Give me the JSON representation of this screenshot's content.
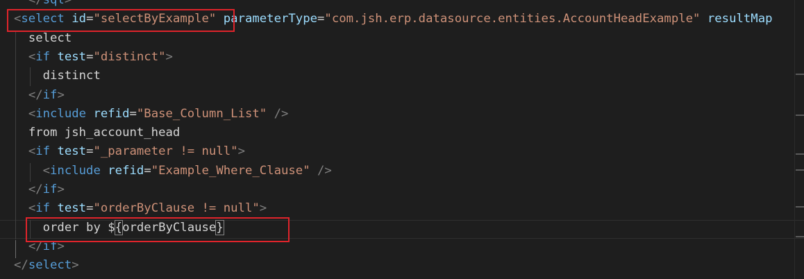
{
  "editor": {
    "lines": [
      {
        "indent": "  ",
        "parts": [
          [
            "punct",
            "</"
          ],
          [
            "tag",
            "sql"
          ],
          [
            "punct",
            ">"
          ]
        ]
      },
      {
        "indent": "",
        "parts": [
          [
            "punct",
            "<"
          ],
          [
            "tag",
            "select"
          ],
          [
            "text",
            " "
          ],
          [
            "attr",
            "id"
          ],
          [
            "eq",
            "="
          ],
          [
            "str",
            "\"selectByExample\""
          ],
          [
            "text",
            " "
          ],
          [
            "attr",
            "parameterType"
          ],
          [
            "eq",
            "="
          ],
          [
            "str",
            "\"com.jsh.erp.datasource.entities.AccountHeadExample\""
          ],
          [
            "text",
            " "
          ],
          [
            "attr",
            "resultMap"
          ]
        ]
      },
      {
        "indent": "  ",
        "parts": [
          [
            "text",
            "select"
          ]
        ]
      },
      {
        "indent": "  ",
        "parts": [
          [
            "punct",
            "<"
          ],
          [
            "tag",
            "if"
          ],
          [
            "text",
            " "
          ],
          [
            "attr",
            "test"
          ],
          [
            "eq",
            "="
          ],
          [
            "str",
            "\"distinct\""
          ],
          [
            "punct",
            ">"
          ]
        ]
      },
      {
        "indent": "    ",
        "parts": [
          [
            "text",
            "distinct"
          ]
        ]
      },
      {
        "indent": "  ",
        "parts": [
          [
            "punct",
            "</"
          ],
          [
            "tag",
            "if"
          ],
          [
            "punct",
            ">"
          ]
        ]
      },
      {
        "indent": "  ",
        "parts": [
          [
            "punct",
            "<"
          ],
          [
            "tag",
            "include"
          ],
          [
            "text",
            " "
          ],
          [
            "attr",
            "refid"
          ],
          [
            "eq",
            "="
          ],
          [
            "str",
            "\"Base_Column_List\""
          ],
          [
            "text",
            " "
          ],
          [
            "punct",
            "/>"
          ]
        ]
      },
      {
        "indent": "  ",
        "parts": [
          [
            "text",
            "from jsh_account_head"
          ]
        ]
      },
      {
        "indent": "  ",
        "parts": [
          [
            "punct",
            "<"
          ],
          [
            "tag",
            "if"
          ],
          [
            "text",
            " "
          ],
          [
            "attr",
            "test"
          ],
          [
            "eq",
            "="
          ],
          [
            "str",
            "\"_parameter != null\""
          ],
          [
            "punct",
            ">"
          ]
        ]
      },
      {
        "indent": "    ",
        "parts": [
          [
            "punct",
            "<"
          ],
          [
            "tag",
            "include"
          ],
          [
            "text",
            " "
          ],
          [
            "attr",
            "refid"
          ],
          [
            "eq",
            "="
          ],
          [
            "str",
            "\"Example_Where_Clause\""
          ],
          [
            "text",
            " "
          ],
          [
            "punct",
            "/>"
          ]
        ]
      },
      {
        "indent": "  ",
        "parts": [
          [
            "punct",
            "</"
          ],
          [
            "tag",
            "if"
          ],
          [
            "punct",
            ">"
          ]
        ]
      },
      {
        "indent": "  ",
        "parts": [
          [
            "punct",
            "<"
          ],
          [
            "tag",
            "if"
          ],
          [
            "text",
            " "
          ],
          [
            "attr",
            "test"
          ],
          [
            "eq",
            "="
          ],
          [
            "str",
            "\"orderByClause != null\""
          ],
          [
            "punct",
            ">"
          ]
        ]
      },
      {
        "indent": "    ",
        "parts": [
          [
            "text",
            "order by $"
          ],
          [
            "brace",
            "{"
          ],
          [
            "text",
            "orderByClause"
          ],
          [
            "brace",
            "}"
          ]
        ]
      },
      {
        "indent": "  ",
        "parts": [
          [
            "punct",
            "</"
          ],
          [
            "tag",
            "if"
          ],
          [
            "punct",
            ">"
          ]
        ]
      },
      {
        "indent": "",
        "parts": [
          [
            "punct",
            "</"
          ],
          [
            "tag",
            "select"
          ],
          [
            "punct",
            ">"
          ]
        ]
      }
    ]
  },
  "colors": {
    "background": "#1e1e1e",
    "tag": "#569cd6",
    "attribute": "#9cdcfe",
    "string": "#ce9178",
    "punctuation": "#808080",
    "text": "#d4d4d4",
    "annotation_box": "#e0242b"
  }
}
